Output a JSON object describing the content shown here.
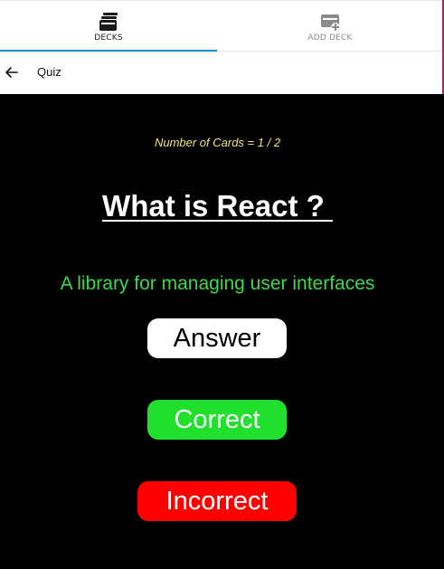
{
  "tabs": [
    {
      "label": "DECKS",
      "icon": "cards-icon",
      "active": true
    },
    {
      "label": "ADD DECK",
      "icon": "add-card-icon",
      "active": false
    }
  ],
  "header": {
    "back_icon": "arrow-left-icon",
    "title": "Quiz"
  },
  "quiz": {
    "card_count": "Number of Cards = 1 / 2",
    "question": "What is React ? ",
    "answer": "A library for managing user interfaces",
    "answer_button": "Answer",
    "correct_button": "Correct",
    "incorrect_button": "Incorrect"
  },
  "colors": {
    "background": "#000000",
    "card_count": "#f1e67a",
    "answer_text": "#3dd94a",
    "correct": "#21e02b",
    "incorrect": "#ff0000",
    "tab_indicator": "#1a8cd8"
  }
}
